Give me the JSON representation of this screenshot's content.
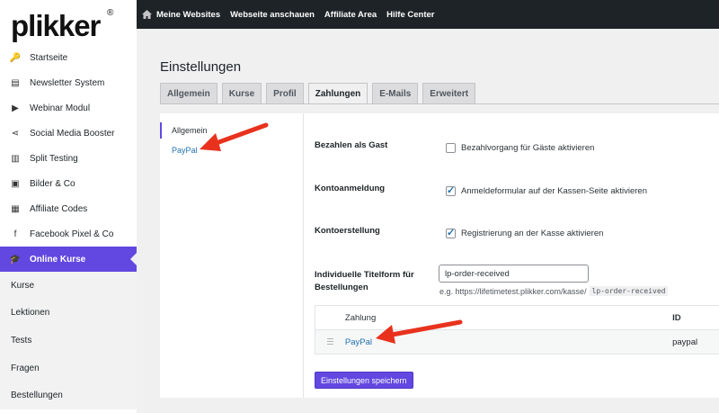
{
  "brand": {
    "logo": "plikker",
    "reg": "®"
  },
  "sidebar": {
    "items": [
      {
        "label": "Startseite",
        "icon": "🔑"
      },
      {
        "label": "Newsletter System",
        "icon": "▤"
      },
      {
        "label": "Webinar Modul",
        "icon": "▶"
      },
      {
        "label": "Social Media Booster",
        "icon": "⋖"
      },
      {
        "label": "Split Testing",
        "icon": "▥"
      },
      {
        "label": "Bilder & Co",
        "icon": "▣"
      },
      {
        "label": "Affiliate Codes",
        "icon": "▦"
      },
      {
        "label": "Facebook Pixel & Co",
        "icon": "f"
      },
      {
        "label": "Online Kurse",
        "icon": "🎓"
      }
    ],
    "subitems": [
      "Kurse",
      "Lektionen",
      "Tests",
      "Fragen",
      "Bestellungen"
    ]
  },
  "topbar": {
    "items": [
      "Meine Websites",
      "Webseite anschauen",
      "Affiliate Area",
      "Hilfe Center"
    ]
  },
  "page": {
    "title": "Einstellungen",
    "tabs": [
      "Allgemein",
      "Kurse",
      "Profil",
      "Zahlungen",
      "E-Mails",
      "Erweitert"
    ]
  },
  "subnav": {
    "items": [
      "Allgemein",
      "PayPal"
    ]
  },
  "settings": {
    "guest": {
      "label": "Bezahlen als Gast",
      "option": "Bezahlvorgang für Gäste aktivieren",
      "checked": false
    },
    "login": {
      "label": "Kontoanmeldung",
      "option": "Anmeldeformular auf der Kassen-Seite aktivieren",
      "checked": true
    },
    "register": {
      "label": "Kontoerstellung",
      "option": "Registrierung an der Kasse aktivieren",
      "checked": true
    },
    "titleform": {
      "label1": "Individuelle Titelform für",
      "label2": "Bestellungen",
      "value": "lp-order-received",
      "hint": "e.g. https://lifetimetest.plikker.com/kasse/",
      "hint_code": "lp-order-received"
    }
  },
  "table": {
    "headers": {
      "payment": "Zahlung",
      "id": "ID"
    },
    "rows": [
      {
        "name": "PayPal",
        "id": "paypal"
      }
    ]
  },
  "save_label": "Einstellungen speichern",
  "colors": {
    "accent": "#6248e0",
    "adminbar": "#1d2327",
    "link": "#2271b1",
    "arrow": "#e8321e"
  }
}
